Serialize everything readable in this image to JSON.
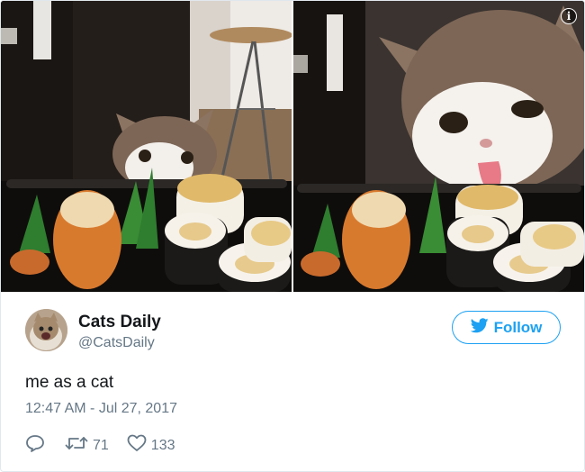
{
  "tweet": {
    "display_name": "Cats Daily",
    "handle": "@CatsDaily",
    "follow_label": "Follow",
    "text": "me as a cat",
    "timestamp": "12:47 AM - Jul 27, 2017",
    "retweet_count": "71",
    "like_count": "133"
  },
  "media": {
    "left_image": "cat-peeking-over-sushi-tray-photo",
    "right_image": "cat-licking-sushi-photo",
    "info_icon_glyph": "i"
  },
  "icons": {
    "reply": "reply-icon",
    "retweet": "retweet-icon",
    "like": "heart-icon",
    "follow_bird": "twitter-bird-icon",
    "info": "info-icon"
  },
  "colors": {
    "accent": "#1da1f2",
    "secondary_text": "#657786",
    "primary_text": "#14171a",
    "border": "#e1e8ed"
  }
}
